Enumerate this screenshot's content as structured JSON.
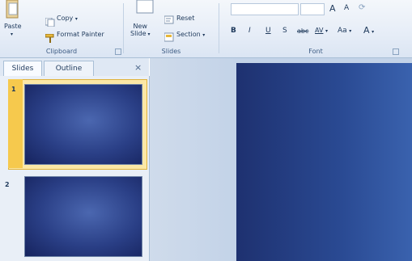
{
  "clipboard": {
    "paste_label": "Paste",
    "copy_label": "Copy",
    "format_painter_label": "Format Painter",
    "group_label": "Clipboard"
  },
  "slides_group": {
    "new_slide_label_line1": "New",
    "new_slide_label_line2": "Slide",
    "reset_label": "Reset",
    "section_label": "Section",
    "group_label": "Slides"
  },
  "font_group": {
    "bold": "B",
    "italic": "I",
    "underline": "U",
    "shadow": "S",
    "strikethrough": "abc",
    "char_spacing": "AV",
    "change_case": "Aa",
    "font_color": "A",
    "group_label": "Font"
  },
  "panel": {
    "tabs": [
      "Slides",
      "Outline"
    ],
    "close": "×",
    "thumbnails": [
      {
        "number": "1",
        "selected": true
      },
      {
        "number": "2",
        "selected": false
      }
    ]
  },
  "colors": {
    "accent_selected": "#f6c94d",
    "slide_dark": "#16235e",
    "slide_light": "#4b67b0"
  }
}
